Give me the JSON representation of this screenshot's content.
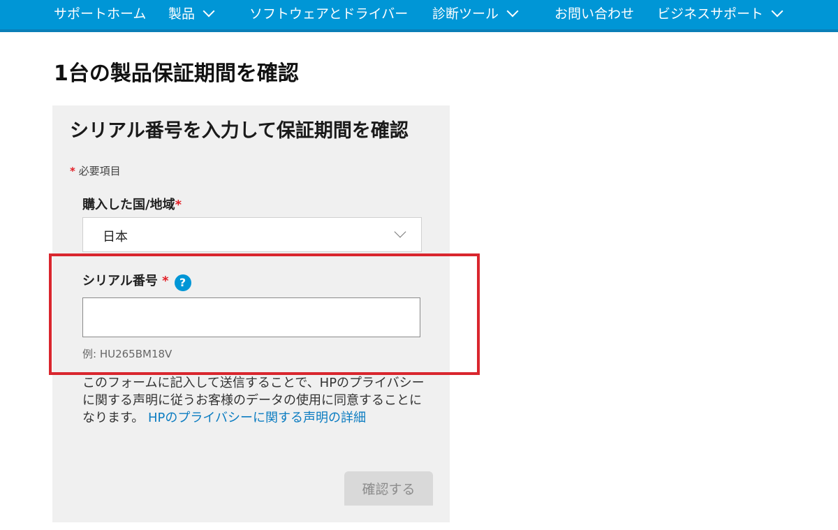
{
  "nav": {
    "items": [
      {
        "label": "サポートホーム",
        "has_dropdown": false
      },
      {
        "label": "製品",
        "has_dropdown": true
      },
      {
        "label": "ソフトウェアとドライバー",
        "has_dropdown": false
      },
      {
        "label": "診断ツール",
        "has_dropdown": true
      },
      {
        "label": "お問い合わせ",
        "has_dropdown": false
      },
      {
        "label": "ビジネスサポート",
        "has_dropdown": true
      }
    ],
    "background_color": "#0096d6"
  },
  "page": {
    "title": "1台の製品保証期間を確認"
  },
  "form": {
    "title": "シリアル番号を入力して保証期間を確認",
    "required_marker": "*",
    "required_note": "必要項目",
    "country": {
      "label": "購入した国/地域",
      "selected": "日本"
    },
    "serial": {
      "label": "シリアル番号",
      "help_glyph": "?",
      "value": "",
      "example": "例: HU265BM18V"
    },
    "privacy": {
      "text": "このフォームに記入して送信することで、HPのプライバシーに関する声明に従うお客様のデータの使用に同意することになります。",
      "link_text": "HPのプライバシーに関する声明の詳細"
    },
    "submit_label": "確認する",
    "submit_enabled": false
  },
  "colors": {
    "accent": "#0096d6",
    "link": "#0b7cc1",
    "required": "#e21e26",
    "highlight_border": "#d9262e",
    "card_background": "#f0f0f0"
  }
}
